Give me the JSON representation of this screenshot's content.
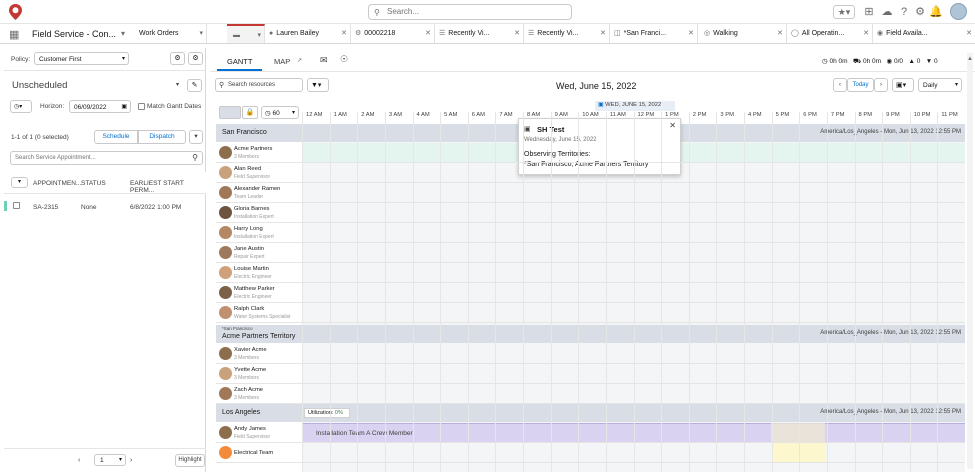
{
  "search": {
    "placeholder": "Search..."
  },
  "app": {
    "title": "Field Service - Con..."
  },
  "tabs": [
    {
      "label": "Work Orders",
      "icon": "none"
    },
    {
      "label": "",
      "icon": "record-icon"
    },
    {
      "label": "Lauren Bailey",
      "icon": "person-icon"
    },
    {
      "label": "00002218",
      "icon": "record-icon"
    },
    {
      "label": "Recently Vi...",
      "icon": "list-icon"
    },
    {
      "label": "Recently Vi...",
      "icon": "list-icon"
    },
    {
      "label": "*San Franci...",
      "icon": "territory-icon"
    },
    {
      "label": "Walking",
      "icon": "walk-icon"
    },
    {
      "label": "All Operatin...",
      "icon": "list-icon"
    },
    {
      "label": "Field Availa...",
      "icon": "eye-icon"
    }
  ],
  "left": {
    "policy_label": "Policy:",
    "policy_value": "Customer First",
    "unscheduled": "Unscheduled",
    "horizon_label": "Horizon:",
    "horizon_value": "06/09/2022",
    "match_label": "Match Gantt Dates",
    "count": "1-1 of 1 (0 selected)",
    "schedule": "Schedule",
    "dispatch": "Dispatch",
    "search_placeholder": "Search Service Appointment...",
    "col_appt": "APPOINTMEN...",
    "col_status": "STATUS",
    "col_start": "EARLIEST START PERM...",
    "row": {
      "appt": "SA-2315",
      "status": "None",
      "start": "6/8/2022 1:00 PM"
    },
    "page": "1",
    "highlight": "Highlight"
  },
  "right": {
    "tab_gantt": "GANTT",
    "tab_map": "MAP",
    "stats": [
      "0h 0m",
      "0h 0m",
      "0/0",
      "0",
      "0"
    ],
    "search_resources": "Search resources",
    "date": "Wed, June 15, 2022",
    "today": "Today",
    "view": "Daily",
    "zoom": "60",
    "day_banner": "WED, JUNE 15, 2022",
    "hours": [
      "12 AM",
      "1 AM",
      "2 AM",
      "3 AM",
      "4 AM",
      "5 AM",
      "6 AM",
      "7 AM",
      "8 AM",
      "9 AM",
      "10 AM",
      "11 AM",
      "12 PM",
      "1 PM",
      "2 PM",
      "3 PM",
      "4 PM",
      "5 PM",
      "6 PM",
      "7 PM",
      "8 PM",
      "9 PM",
      "10 PM",
      "11 PM"
    ],
    "groups": [
      {
        "name": "San Francisco",
        "tz": "America/Los_Angeles - Mon, Jun 13, 2022 12:55 PM",
        "super": ""
      },
      {
        "name": "Acme Partners Territory",
        "tz": "America/Los_Angeles - Mon, Jun 13, 2022 12:55 PM",
        "super": "*San Francisco"
      },
      {
        "name": "Los Angeles",
        "tz": "America/Los_Angeles - Mon, Jun 13, 2022 12:55 PM",
        "super": ""
      }
    ],
    "resources_sf": [
      {
        "name": "Acme Partners",
        "sub": "3 Members"
      },
      {
        "name": "Alan Reed",
        "sub": "Field Supervisor"
      },
      {
        "name": "Alexander Ramen",
        "sub": "Team Leader"
      },
      {
        "name": "Gloria Barnes",
        "sub": "Installation Expert"
      },
      {
        "name": "Harry Long",
        "sub": "Installation Expert"
      },
      {
        "name": "Jane Austin",
        "sub": "Repair Expert"
      },
      {
        "name": "Louise Martin",
        "sub": "Electric Engineer"
      },
      {
        "name": "Matthew Parker",
        "sub": "Electric Engineer"
      },
      {
        "name": "Ralph Clark",
        "sub": "Water Systems Specialist"
      }
    ],
    "resources_acme": [
      {
        "name": "Xavier Acme",
        "sub": "3 Members"
      },
      {
        "name": "Yvette Acme",
        "sub": "3 Members"
      },
      {
        "name": "Zach Acme",
        "sub": "3 Members"
      }
    ],
    "resources_la": [
      {
        "name": "Andy James",
        "sub": "Field Supervisor"
      },
      {
        "name": "Electrical Team",
        "sub": ""
      }
    ],
    "utilization_label": "Utilization:",
    "utilization_value": "0%",
    "crew_bar": "Installation Team A Crew Member",
    "popup": {
      "title": "SH Test",
      "date": "Wednesday, June 15, 2022",
      "obs_label": "Observing Territories:",
      "obs_value": "*San Francisco, Acme Partners Territory"
    }
  }
}
